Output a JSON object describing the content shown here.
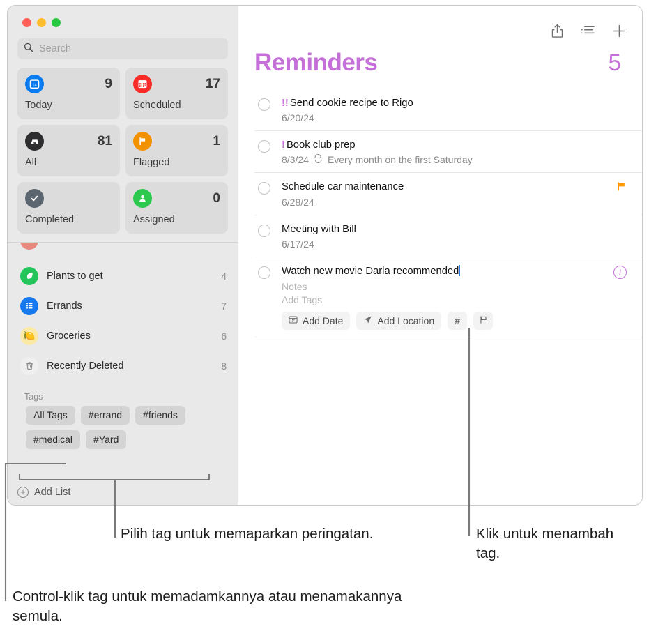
{
  "window": {
    "traffic_lights": [
      "close",
      "minimize",
      "maximize"
    ]
  },
  "sidebar": {
    "search": {
      "placeholder": "Search",
      "icon": "search-icon"
    },
    "smart_lists": [
      {
        "label": "Today",
        "count": "9",
        "icon": "calendar-today-icon",
        "color": "#0a7cf0"
      },
      {
        "label": "Scheduled",
        "count": "17",
        "icon": "calendar-scheduled-icon",
        "color": "#fa2c29"
      },
      {
        "label": "All",
        "count": "81",
        "icon": "inbox-tray-icon",
        "color": "#2e2e30"
      },
      {
        "label": "Flagged",
        "count": "1",
        "icon": "flag-icon",
        "color": "#f39200"
      },
      {
        "label": "Completed",
        "count": "",
        "icon": "checkmark-icon",
        "color": "#5b6670"
      },
      {
        "label": "Assigned",
        "count": "0",
        "icon": "person-icon",
        "color": "#2dc94f"
      }
    ],
    "lists": [
      {
        "label": "Plants to get",
        "count": "4",
        "icon": "leaf-icon",
        "color": "#23c65a",
        "glyph": "❦"
      },
      {
        "label": "Errands",
        "count": "7",
        "icon": "bullet-list-icon",
        "color": "#1878f0",
        "glyph": "☰"
      },
      {
        "label": "Groceries",
        "count": "6",
        "icon": "lemon-icon",
        "color": "#fbe9a8",
        "glyph": "🍋"
      },
      {
        "label": "Recently Deleted",
        "count": "8",
        "icon": "trash-icon",
        "color": "#efefef",
        "glyph": "🗑"
      }
    ],
    "tags_header": "Tags",
    "tags": [
      "All Tags",
      "#errand",
      "#friends",
      "#medical",
      "#Yard"
    ],
    "add_list_label": "Add List",
    "add_list_icon": "plus-circle-icon"
  },
  "main": {
    "toolbar": [
      {
        "name": "share-icon",
        "label": "Share"
      },
      {
        "name": "view-options-icon",
        "label": "View Options"
      },
      {
        "name": "add-reminder-icon",
        "label": "Add Reminder"
      }
    ],
    "title": "Reminders",
    "count": "5",
    "title_color": "#c56fd8",
    "reminders": [
      {
        "priority": "!!",
        "title": "Send cookie recipe to Rigo",
        "date": "6/20/24",
        "repeat": "",
        "flagged": false,
        "editing": false
      },
      {
        "priority": "!",
        "title": "Book club prep",
        "date": "8/3/24",
        "repeat": "Every month on the first Saturday",
        "flagged": false,
        "editing": false
      },
      {
        "priority": "",
        "title": "Schedule car maintenance",
        "date": "6/28/24",
        "repeat": "",
        "flagged": true,
        "editing": false
      },
      {
        "priority": "",
        "title": "Meeting with Bill",
        "date": "6/17/24",
        "repeat": "",
        "flagged": false,
        "editing": false
      },
      {
        "priority": "",
        "title": "Watch new movie Darla recommended",
        "date": "",
        "repeat": "",
        "flagged": false,
        "editing": true,
        "notes_placeholder": "Notes",
        "tags_placeholder": "Add Tags",
        "chips": [
          {
            "label": "Add Date",
            "icon": "calendar-icon"
          },
          {
            "label": "Add Location",
            "icon": "location-arrow-icon"
          },
          {
            "label": "#",
            "icon": "hash-icon"
          },
          {
            "label": "",
            "icon": "flag-outline-icon"
          }
        ],
        "info_icon": "info-circle-icon"
      }
    ]
  },
  "callouts": [
    {
      "id": "tags",
      "text": "Pilih tag untuk memaparkan peringatan."
    },
    {
      "id": "hash",
      "text": "Klik untuk menambah tag."
    },
    {
      "id": "control",
      "text": "Control-klik tag untuk memadamkannya atau menamakannya semula."
    }
  ]
}
